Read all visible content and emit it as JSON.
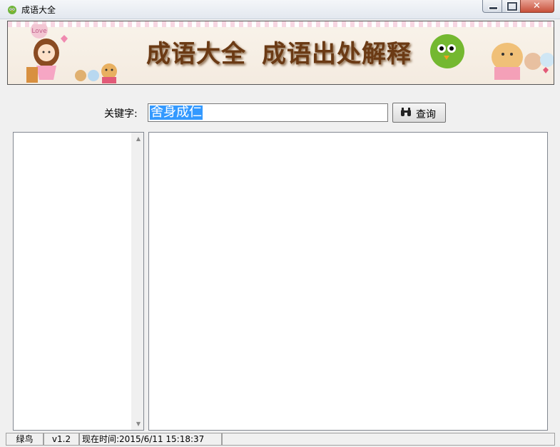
{
  "window": {
    "title": "成语大全",
    "close_glyph": "✕"
  },
  "banner": {
    "title_part1": "成语大全",
    "title_part2": "成语出处解释",
    "logo_text": "Love"
  },
  "search": {
    "label": "关键字:",
    "value": "舍身成仁",
    "button_label": "查询",
    "button_icon": "binoculars-icon"
  },
  "status": {
    "name": "绿鸟",
    "version": "v1.2",
    "time": "现在时间:2015/6/11 15:18:37"
  },
  "colors": {
    "banner_text": "#6b3a14",
    "selection": "#3399ff",
    "close_button": "#c7503a"
  }
}
